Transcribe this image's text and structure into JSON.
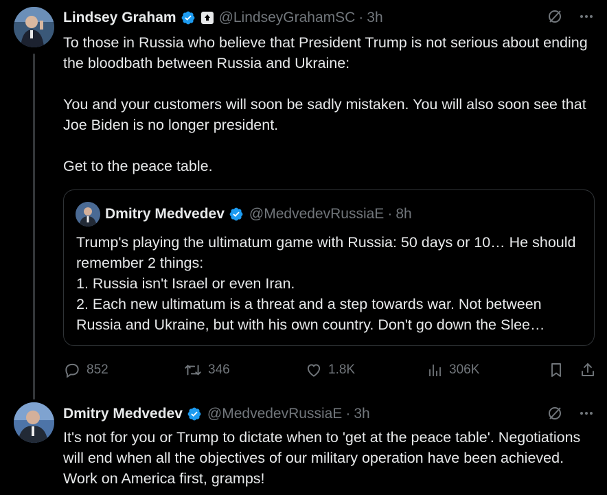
{
  "tweet1": {
    "author_name": "Lindsey Graham",
    "author_handle": "@LindseyGrahamSC",
    "time": "3h",
    "separator": "·",
    "paragraphs": [
      "To those in Russia who believe that President Trump is not serious about ending the bloodbath between Russia and Ukraine:",
      "You and your customers will soon be sadly mistaken. You will also soon see that Joe Biden is no longer president.",
      "Get to the peace table."
    ],
    "quote": {
      "author_name": "Dmitry Medvedev",
      "author_handle": "@MedvedevRussiaE",
      "time": "8h",
      "separator": "·",
      "lines": [
        "Trump's playing the ultimatum game with Russia: 50 days or 10… He should remember 2 things:",
        "1. Russia isn't Israel or even Iran.",
        "2. Each new ultimatum is a threat and a step towards war. Not between Russia and Ukraine, but with his own country. Don't go down the Slee…"
      ]
    },
    "stats": {
      "replies": "852",
      "reposts": "346",
      "likes": "1.8K",
      "views": "306K"
    }
  },
  "tweet2": {
    "author_name": "Dmitry Medvedev",
    "author_handle": "@MedvedevRussiaE",
    "time": "3h",
    "separator": "·",
    "text": "It's not for you or Trump to dictate when to 'get at the peace table'. Negotiations will end when all the objectives of our military operation have been achieved. Work on America first, gramps!"
  },
  "colors": {
    "background": "#000000",
    "text": "#e7e9ea",
    "muted": "#71767b",
    "verified_blue": "#1d9bf0",
    "border": "#2f3336"
  }
}
